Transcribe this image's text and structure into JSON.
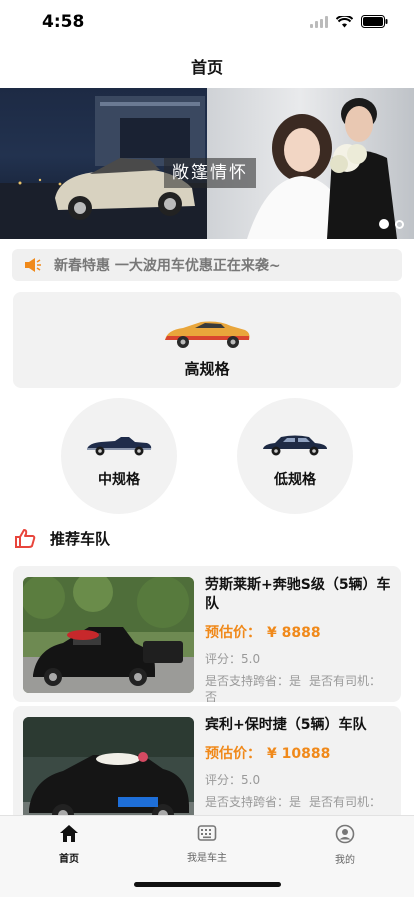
{
  "status_bar": {
    "time": "4:58"
  },
  "nav": {
    "title": "首页"
  },
  "banner": {
    "caption": "敞篷情怀",
    "slide_count": 2,
    "active_slide": 1
  },
  "notice": {
    "text": "新春特惠 一大波用车优惠正在来袭~",
    "icon": "speaker-icon"
  },
  "categories": {
    "high": {
      "label": "高规格",
      "icon": "sports-car-icon"
    },
    "mid": {
      "label": "中规格",
      "icon": "convertible-car-icon"
    },
    "low": {
      "label": "低规格",
      "icon": "sedan-car-icon"
    }
  },
  "recommend": {
    "title": "推荐车队",
    "icon": "thumbs-up-icon"
  },
  "fleets": [
    {
      "name": "劳斯莱斯+奔驰S级（5辆）车队",
      "price_label": "预估价：",
      "price": "¥ 8888",
      "rating": "评分：5.0",
      "cross_province": "是否支持跨省：是",
      "has_driver": "是否有司机：否"
    },
    {
      "name": "宾利+保时捷（5辆）车队",
      "price_label": "预估价：",
      "price": "¥ 10888",
      "rating": "评分：5.0",
      "cross_province": "是否支持跨省：是",
      "has_driver": "是否有司机："
    }
  ],
  "tabs": [
    {
      "label": "首页",
      "icon": "home-icon",
      "active": true
    },
    {
      "label": "我是车主",
      "icon": "keyboard-icon",
      "active": false
    },
    {
      "label": "我的",
      "icon": "user-icon",
      "active": false
    }
  ],
  "colors": {
    "accent": "#f0891a",
    "icon_red": "#e8453c",
    "card_bg": "#f2f2f2"
  }
}
